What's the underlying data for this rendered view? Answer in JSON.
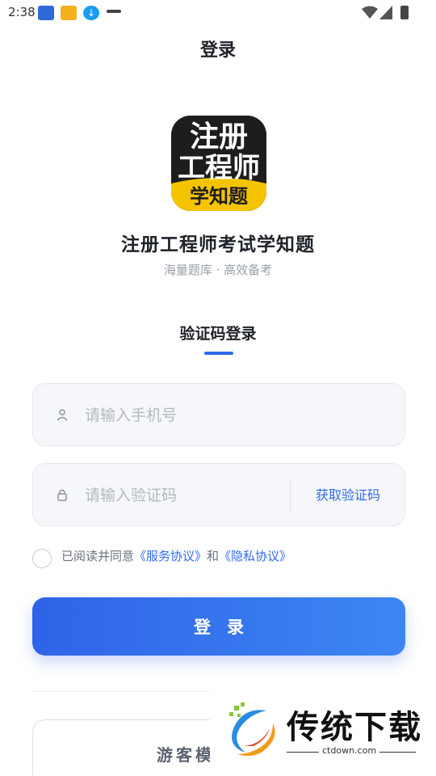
{
  "status_bar": {
    "time": "2:38",
    "icons": [
      "app-notification-1",
      "app-notification-2",
      "download-icon",
      "app-notification-4",
      "wifi-icon",
      "signal-icon",
      "battery-icon"
    ]
  },
  "header": {
    "title": "登录"
  },
  "app": {
    "logo_lines": [
      "注册",
      "工程师",
      "学知题"
    ],
    "name": "注册工程师考试学知题",
    "slogan": "海量题库 · 高效备考"
  },
  "login": {
    "tab_label": "验证码登录",
    "phone_placeholder": "请输入手机号",
    "code_placeholder": "请输入验证码",
    "get_code_label": "获取验证码",
    "agreement_prefix": "已阅读并同意",
    "service_link": "《服务协议》",
    "agreement_and": "和",
    "privacy_link": "《隐私协议》",
    "agreement_checked": false,
    "submit_label": "登录",
    "guest_label": "游客模式"
  },
  "watermark": {
    "title": "传统下载",
    "url": "ctdown.com"
  },
  "colors": {
    "accent": "#2f6bea",
    "logo_yellow": "#f5c400"
  }
}
